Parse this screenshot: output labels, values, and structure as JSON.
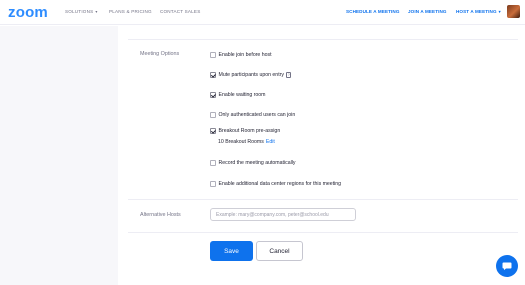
{
  "header": {
    "logo": "zoom",
    "nav_left": [
      {
        "label": "SOLUTIONS",
        "caret": "▾"
      },
      {
        "label": "PLANS & PRICING",
        "caret": ""
      },
      {
        "label": "CONTACT SALES",
        "caret": ""
      }
    ],
    "nav_right": [
      {
        "label": "SCHEDULE A MEETING",
        "caret": ""
      },
      {
        "label": "JOIN A MEETING",
        "caret": ""
      },
      {
        "label": "HOST A MEETING",
        "caret": "▾"
      }
    ]
  },
  "meeting_options": {
    "label": "Meeting Options",
    "options": [
      {
        "label": "Enable join before host",
        "checked": false
      },
      {
        "label": "Mute participants upon entry",
        "checked": true,
        "info_icon": "?"
      },
      {
        "label": "Enable waiting room",
        "checked": true
      },
      {
        "label": "Only authenticated users can join",
        "checked": false
      },
      {
        "label": "Breakout Room pre-assign",
        "checked": true
      },
      {
        "label": "Record the meeting automatically",
        "checked": false
      },
      {
        "label": "Enable additional data center regions for this meeting",
        "checked": false
      }
    ],
    "breakout_subline": {
      "text": "10 Breakout Rooms",
      "edit": "Edit"
    }
  },
  "alternative_hosts": {
    "label": "Alternative Hosts",
    "value": "",
    "placeholder": "Example: mary@company.com, peter@school.edu"
  },
  "actions": {
    "save": "Save",
    "cancel": "Cancel"
  },
  "colors": {
    "accent": "#0e72ed",
    "logo": "#2d8cff",
    "sidebar_bg": "#f7f7fa"
  },
  "icons": {
    "chat": "chat-bubble-icon",
    "info": "info-icon",
    "checkmark": "checkmark-icon"
  }
}
